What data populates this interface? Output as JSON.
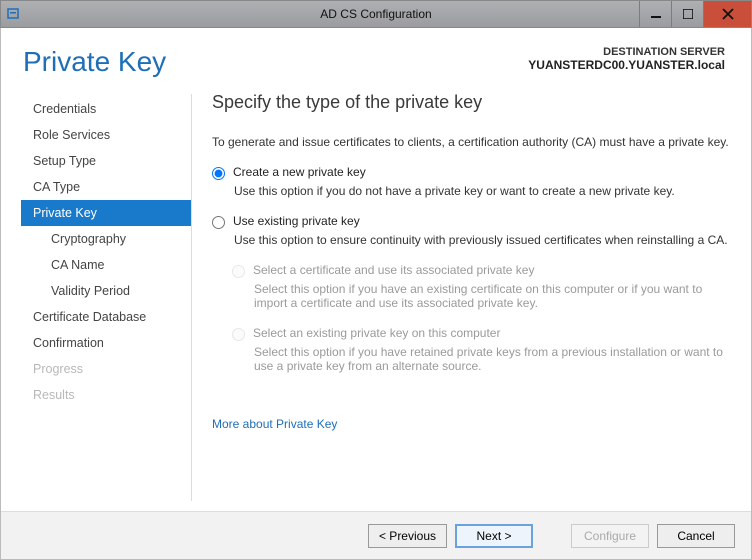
{
  "window": {
    "title": "AD CS Configuration"
  },
  "header": {
    "page_title": "Private Key",
    "dest_label": "DESTINATION SERVER",
    "dest_value": "YUANSTERDC00.YUANSTER.local"
  },
  "sidebar": {
    "items": [
      {
        "label": "Credentials",
        "selected": false,
        "sub": false,
        "disabled": false
      },
      {
        "label": "Role Services",
        "selected": false,
        "sub": false,
        "disabled": false
      },
      {
        "label": "Setup Type",
        "selected": false,
        "sub": false,
        "disabled": false
      },
      {
        "label": "CA Type",
        "selected": false,
        "sub": false,
        "disabled": false
      },
      {
        "label": "Private Key",
        "selected": true,
        "sub": false,
        "disabled": false
      },
      {
        "label": "Cryptography",
        "selected": false,
        "sub": true,
        "disabled": false
      },
      {
        "label": "CA Name",
        "selected": false,
        "sub": true,
        "disabled": false
      },
      {
        "label": "Validity Period",
        "selected": false,
        "sub": true,
        "disabled": false
      },
      {
        "label": "Certificate Database",
        "selected": false,
        "sub": false,
        "disabled": false
      },
      {
        "label": "Confirmation",
        "selected": false,
        "sub": false,
        "disabled": false
      },
      {
        "label": "Progress",
        "selected": false,
        "sub": false,
        "disabled": true
      },
      {
        "label": "Results",
        "selected": false,
        "sub": false,
        "disabled": true
      }
    ]
  },
  "main": {
    "heading": "Specify the type of the private key",
    "intro": "To generate and issue certificates to clients, a certification authority (CA) must have a private key.",
    "opt1_label": "Create a new private key",
    "opt1_desc": "Use this option if you do not have a private key or want to create a new private key.",
    "opt2_label": "Use existing private key",
    "opt2_desc": "Use this option to ensure continuity with previously issued certificates when reinstalling a CA.",
    "sub1_label": "Select a certificate and use its associated private key",
    "sub1_desc": "Select this option if you have an existing certificate on this computer or if you want to import a certificate and use its associated private key.",
    "sub2_label": "Select an existing private key on this computer",
    "sub2_desc": "Select this option if you have retained private keys from a previous installation or want to use a private key from an alternate source.",
    "more_link": "More about Private Key"
  },
  "footer": {
    "previous": "< Previous",
    "next": "Next >",
    "configure": "Configure",
    "cancel": "Cancel"
  }
}
